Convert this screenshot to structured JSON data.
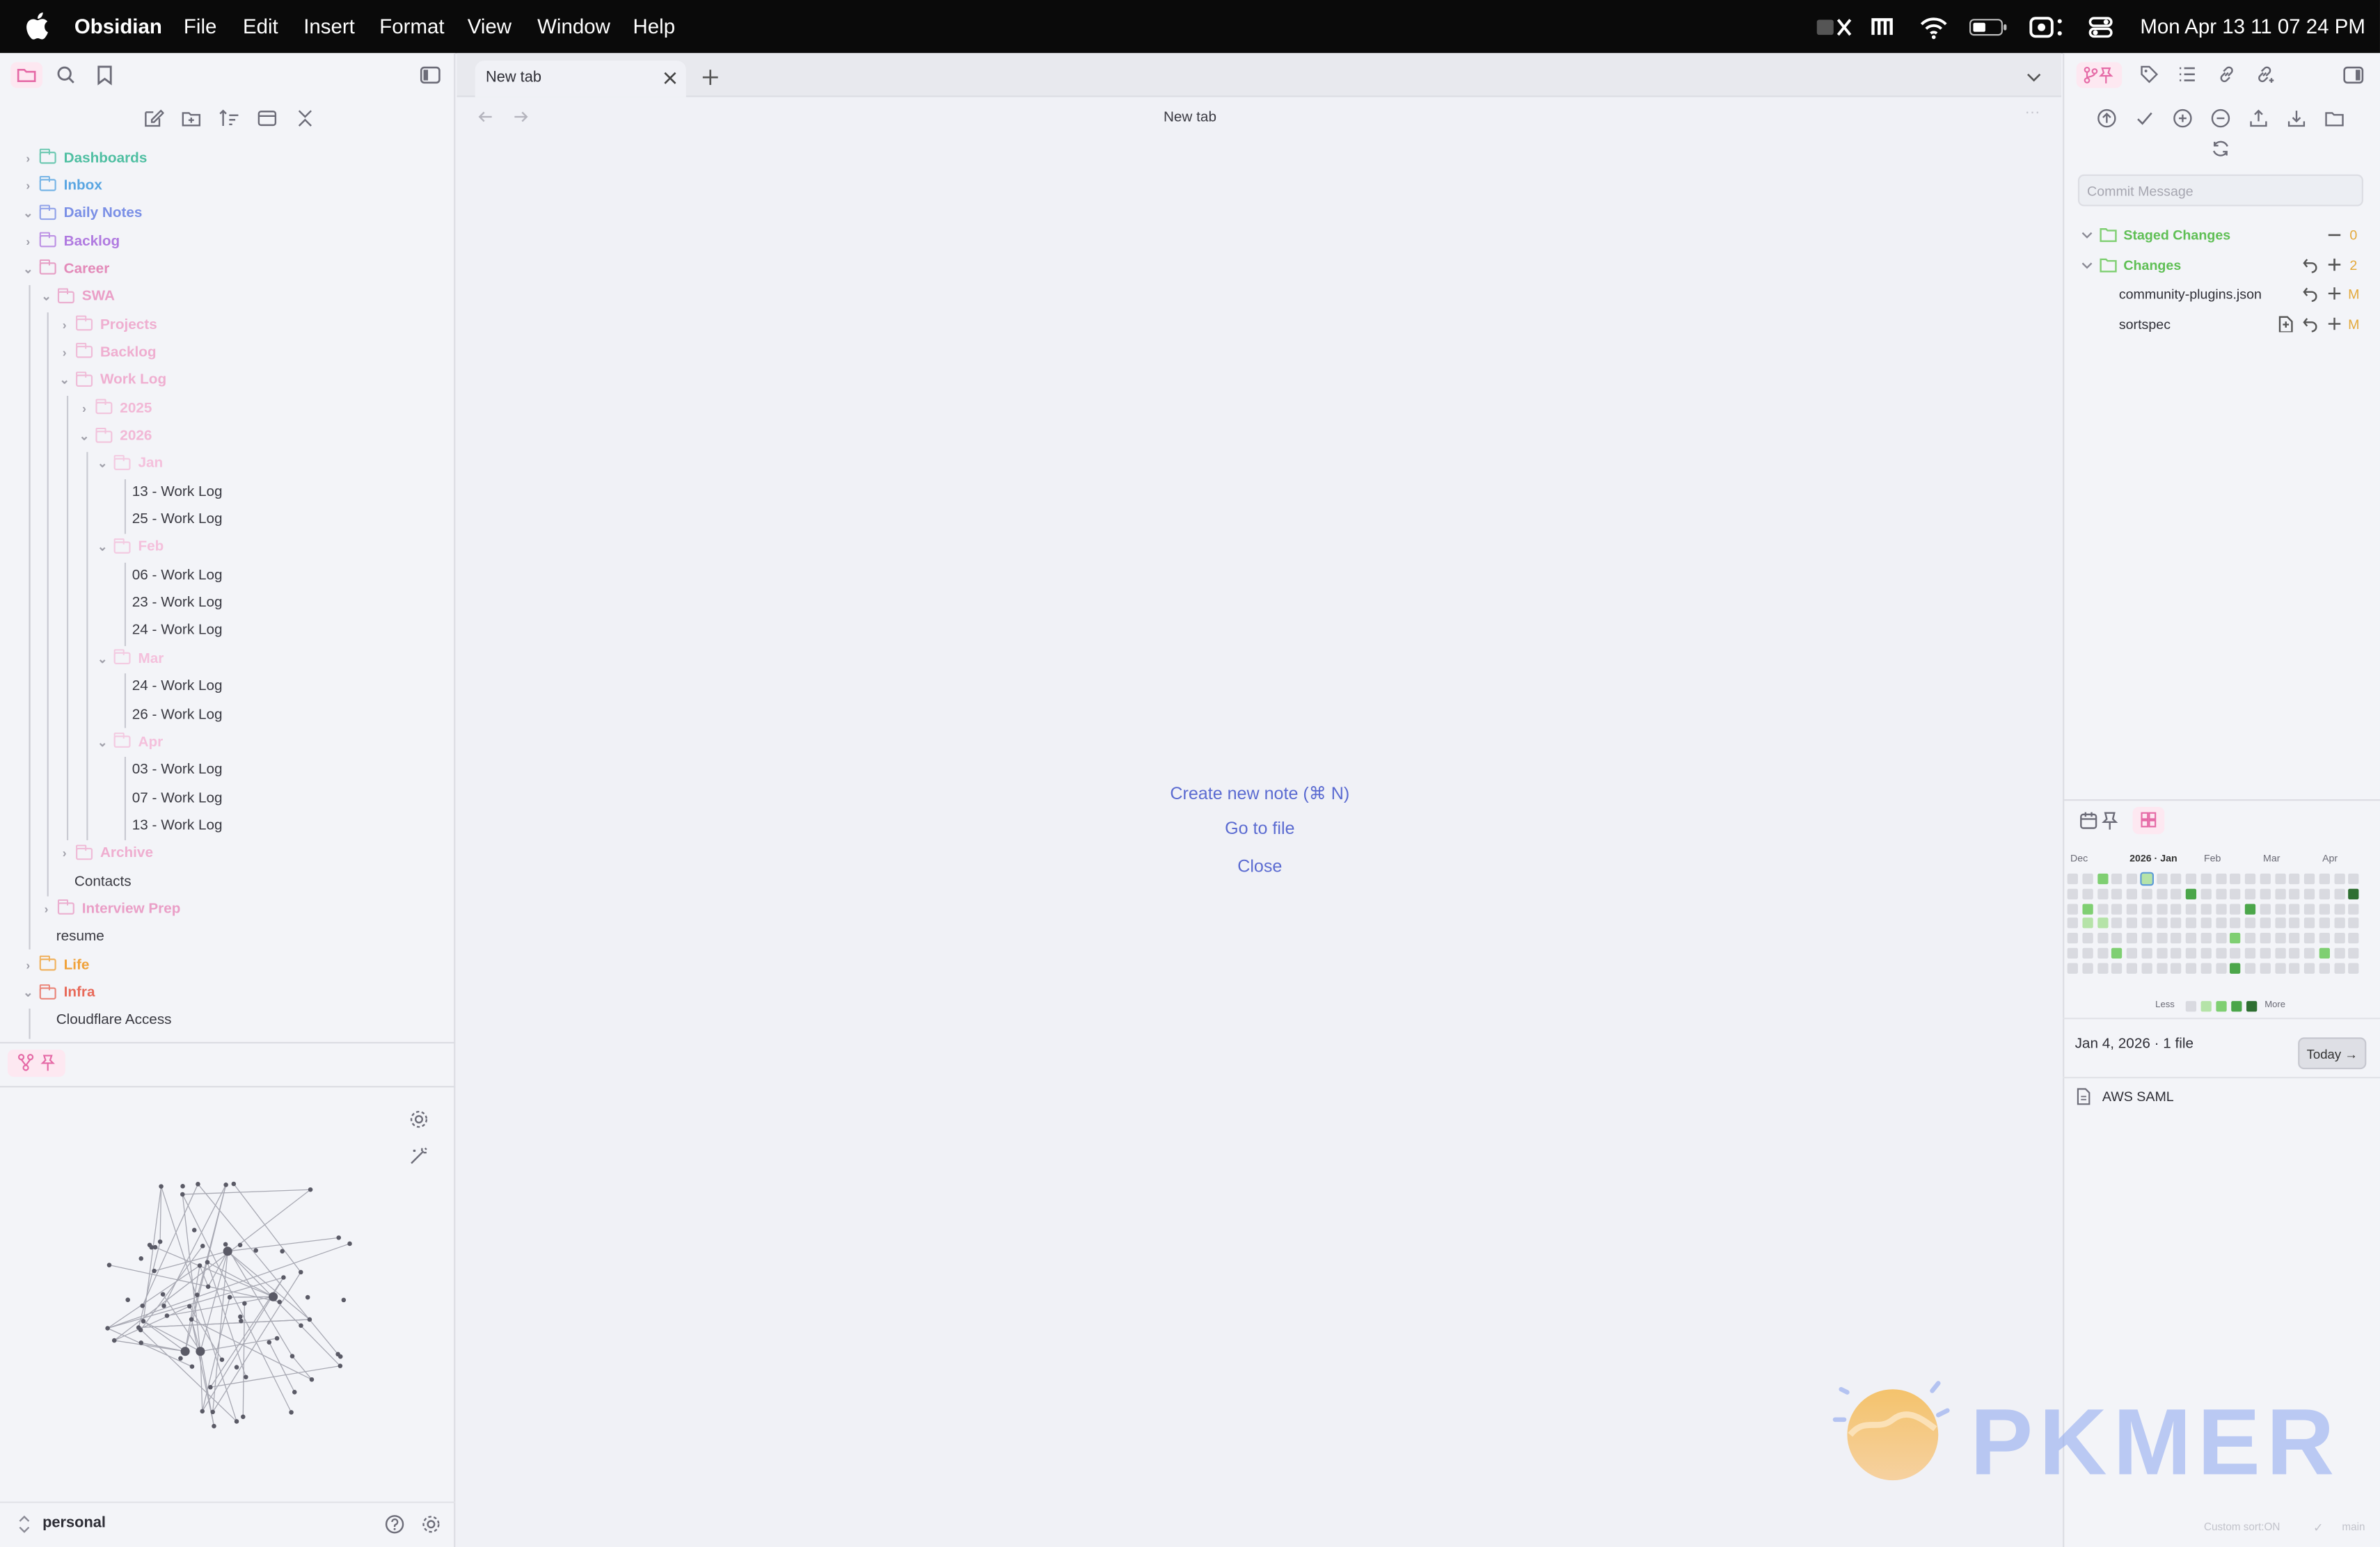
{
  "menubar": {
    "app": "Obsidian",
    "items": [
      "File",
      "Edit",
      "Insert",
      "Format",
      "View",
      "Window",
      "Help"
    ],
    "clock": "Mon Apr 13  11 07 24 PM"
  },
  "left_sidebar": {
    "tree": [
      {
        "label": "Dashboards",
        "kind": "folder",
        "depth": 0,
        "color": "#4fbfa2",
        "open": false
      },
      {
        "label": "Inbox",
        "kind": "folder",
        "depth": 0,
        "color": "#5aa6e2",
        "open": false
      },
      {
        "label": "Daily Notes",
        "kind": "folder",
        "depth": 0,
        "color": "#7a8fe6",
        "open": true
      },
      {
        "label": "Backlog",
        "kind": "folder",
        "depth": 0,
        "color": "#b07ae0",
        "open": false
      },
      {
        "label": "Career",
        "kind": "folder",
        "depth": 0,
        "color": "#e38ab9",
        "open": true
      },
      {
        "label": "SWA",
        "kind": "folder",
        "depth": 1,
        "color": "#ea9fc7",
        "open": true
      },
      {
        "label": "Projects",
        "kind": "folder",
        "depth": 2,
        "color": "#efaed0",
        "open": false
      },
      {
        "label": "Backlog",
        "kind": "folder",
        "depth": 2,
        "color": "#efaed0",
        "open": false
      },
      {
        "label": "Work Log",
        "kind": "folder",
        "depth": 2,
        "color": "#efaed0",
        "open": true
      },
      {
        "label": "2025",
        "kind": "folder",
        "depth": 3,
        "color": "#f2b8d6",
        "open": false
      },
      {
        "label": "2026",
        "kind": "folder",
        "depth": 3,
        "color": "#f2b8d6",
        "open": true
      },
      {
        "label": "Jan",
        "kind": "folder",
        "depth": 4,
        "color": "#f4c0dc",
        "open": true
      },
      {
        "label": "13 - Work Log",
        "kind": "file",
        "depth": 5
      },
      {
        "label": "25 - Work Log",
        "kind": "file",
        "depth": 5
      },
      {
        "label": "Feb",
        "kind": "folder",
        "depth": 4,
        "color": "#f4c0dc",
        "open": true
      },
      {
        "label": "06 - Work Log",
        "kind": "file",
        "depth": 5
      },
      {
        "label": "23 - Work Log",
        "kind": "file",
        "depth": 5
      },
      {
        "label": "24 - Work Log",
        "kind": "file",
        "depth": 5
      },
      {
        "label": "Mar",
        "kind": "folder",
        "depth": 4,
        "color": "#f4c0dc",
        "open": true
      },
      {
        "label": "24 - Work Log",
        "kind": "file",
        "depth": 5
      },
      {
        "label": "26 - Work Log",
        "kind": "file",
        "depth": 5
      },
      {
        "label": "Apr",
        "kind": "folder",
        "depth": 4,
        "color": "#f4c0dc",
        "open": true
      },
      {
        "label": "03 - Work Log",
        "kind": "file",
        "depth": 5
      },
      {
        "label": "07 - Work Log",
        "kind": "file",
        "depth": 5
      },
      {
        "label": "13 - Work Log",
        "kind": "file",
        "depth": 5
      },
      {
        "label": "Archive",
        "kind": "folder",
        "depth": 2,
        "color": "#efaed0",
        "open": false
      },
      {
        "label": "Contacts",
        "kind": "file",
        "depth": 2
      },
      {
        "label": "Interview Prep",
        "kind": "folder",
        "depth": 1,
        "color": "#ea9fc7",
        "open": false
      },
      {
        "label": "resume",
        "kind": "file",
        "depth": 1
      },
      {
        "label": "Life",
        "kind": "folder",
        "depth": 0,
        "color": "#f0a23a",
        "open": false
      },
      {
        "label": "Infra",
        "kind": "folder",
        "depth": 0,
        "color": "#e86a5a",
        "open": true
      },
      {
        "label": "Cloudflare Access",
        "kind": "file",
        "depth": 1
      }
    ],
    "vault_name": "personal"
  },
  "tab": {
    "title": "New tab"
  },
  "center": {
    "title": "New tab",
    "actions": [
      "Create new note (⌘ N)",
      "Go to file",
      "Close"
    ]
  },
  "git": {
    "commit_placeholder": "Commit Message",
    "staged_label": "Staged Changes",
    "staged_count": "0",
    "changes_label": "Changes",
    "changes_count": "2",
    "files": [
      {
        "name": "community-plugins.json",
        "status": "M"
      },
      {
        "name": "sortspec",
        "status": "M"
      }
    ]
  },
  "heatmap": {
    "months": [
      "Dec",
      "2026 · Jan",
      "Feb",
      "Mar",
      "Apr"
    ],
    "legend_less": "Less",
    "legend_more": "More",
    "colors": [
      "#d9dae0",
      "#b5e3a8",
      "#7fcf72",
      "#4ba64a",
      "#2e6f31"
    ],
    "selected_date": "Jan 4, 2026 · 1 file",
    "today_label": "Today →",
    "note": "AWS SAML"
  },
  "status": {
    "sort": "Custom sort:ON",
    "branch": "main"
  },
  "watermark": "PKMER"
}
